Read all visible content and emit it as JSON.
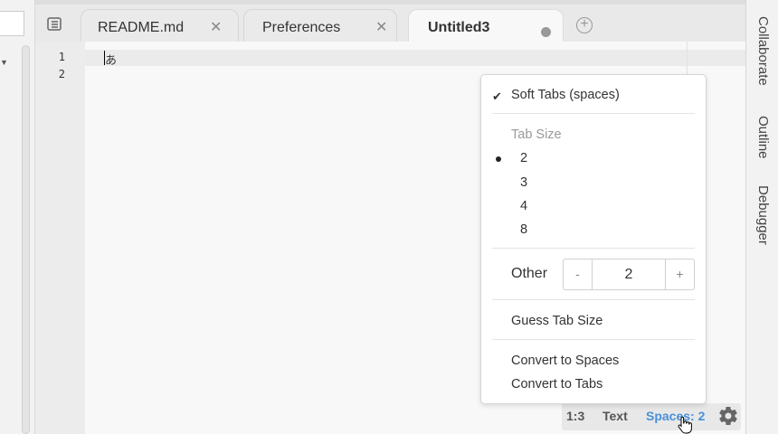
{
  "tabs": [
    {
      "label": "README.md",
      "active": false,
      "modified": false
    },
    {
      "label": "Preferences",
      "active": false,
      "modified": false
    },
    {
      "label": "Untitled3",
      "active": true,
      "modified": true
    }
  ],
  "editor": {
    "line_numbers": [
      "1",
      "2"
    ],
    "first_line_text": "あ"
  },
  "right_panel": {
    "tabs": [
      "Collaborate",
      "Outline",
      "Debugger"
    ]
  },
  "statusbar": {
    "position": "1:3",
    "mode": "Text",
    "indent": "Spaces: 2"
  },
  "menu": {
    "soft_tabs": "Soft Tabs (spaces)",
    "tab_size_header": "Tab Size",
    "sizes": [
      "2",
      "3",
      "4",
      "8"
    ],
    "selected_size": "2",
    "other_label": "Other",
    "other_value": "2",
    "minus": "-",
    "plus": "+",
    "guess": "Guess Tab Size",
    "convert_spaces": "Convert to Spaces",
    "convert_tabs": "Convert to Tabs"
  },
  "colors": {
    "accent": "#4a90d9"
  }
}
